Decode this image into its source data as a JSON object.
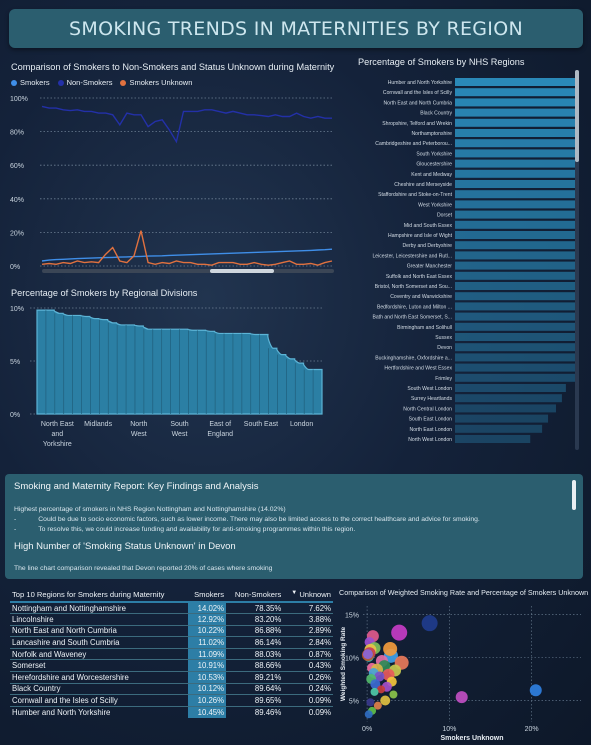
{
  "header": {
    "title": "SMOKING TRENDS IN MATERNITIES BY REGION"
  },
  "line_chart": {
    "title": "Comparison of Smokers to Non-Smokers and Status Unknown during Maternity",
    "legend": [
      {
        "name": "Smokers",
        "color": "#3f8ee8"
      },
      {
        "name": "Non-Smokers",
        "color": "#2330a8"
      },
      {
        "name": "Smokers Unknown",
        "color": "#e0713f"
      }
    ]
  },
  "area_chart": {
    "title": "Percentage of Smokers by Regional Divisions"
  },
  "bar_chart": {
    "title": "Percentage of Smokers by NHS Regions"
  },
  "findings": {
    "heading": "Smoking and Maternity Report: Key Findings and Analysis",
    "line1": "Highest percentage of smokers in NHS Region Nottingham and Nottinghamshire (14.02%)",
    "bullet1_mark": "-",
    "bullet1": "Could be due to socio economic factors, such as lower income. There may also be limited access to the correct healthcare and advice for smoking.",
    "bullet2_mark": "-",
    "bullet2": "To resolve this, we could increase funding and availability for anti-smoking programmes within this region.",
    "subheading": "High Number of 'Smoking Status Unknown' in Devon",
    "line2": "The line chart comparison revealed that Devon reported 20% of cases where smoking"
  },
  "table": {
    "headers": [
      "Top 10 Regions for Smokers during Maternity",
      "Smokers",
      "Non-Smokers",
      "Unknown"
    ],
    "sort_arrow": "▼",
    "rows": [
      [
        "Nottingham and Nottinghamshire",
        "14.02%",
        "78.35%",
        "7.62%"
      ],
      [
        "Lincolnshire",
        "12.92%",
        "83.20%",
        "3.88%"
      ],
      [
        "North East and North Cumbria",
        "10.22%",
        "86.88%",
        "2.89%"
      ],
      [
        "Lancashire and South Cumbria",
        "11.02%",
        "86.14%",
        "2.84%"
      ],
      [
        "Norfolk and Waveney",
        "11.09%",
        "88.03%",
        "0.87%"
      ],
      [
        "Somerset",
        "10.91%",
        "88.66%",
        "0.43%"
      ],
      [
        "Herefordshire and Worcestershire",
        "10.53%",
        "89.21%",
        "0.26%"
      ],
      [
        "Black Country",
        "10.12%",
        "89.64%",
        "0.24%"
      ],
      [
        "Cornwall and the Isles of Scilly",
        "10.26%",
        "89.65%",
        "0.09%"
      ],
      [
        "Humber and North Yorkshire",
        "10.45%",
        "89.46%",
        "0.09%"
      ]
    ]
  },
  "scatter": {
    "title": "Comparison of Weighted Smoking Rate and Percentage of Smokers Unknown",
    "xlabel": "Smokers Unknown",
    "ylabel": "Weighted Smoking Rate"
  },
  "chart_data": [
    {
      "type": "line",
      "title": "Comparison of Smokers to Non-Smokers and Status Unknown during Maternity",
      "ylim": [
        0,
        100
      ],
      "yticks": [
        "0%",
        "20%",
        "40%",
        "60%",
        "80%",
        "100%"
      ],
      "grid": true,
      "legend_position": "top-left",
      "series": [
        {
          "name": "Smokers",
          "color": "#3f8ee8",
          "values": [
            3,
            3.5,
            3.8,
            4,
            4.2,
            4.4,
            4.6,
            4.7,
            4.9,
            5,
            5.1,
            5.3,
            5.4,
            5.6,
            5.7,
            5.9,
            6,
            6.1,
            6.3,
            6.4,
            6.6,
            6.7,
            6.9,
            7,
            7.2,
            7.3,
            7.5,
            7.6,
            7.8,
            7.9,
            8.1,
            8.2,
            8.4,
            8.5,
            8.7,
            8.8,
            9,
            9.1,
            9.3,
            9.5,
            9.7,
            10
          ]
        },
        {
          "name": "Non-Smokers",
          "color": "#2330a8",
          "values": [
            95,
            94,
            94,
            93,
            92.5,
            93,
            92,
            92,
            91,
            91,
            90,
            84,
            91,
            90,
            90,
            83,
            86,
            87,
            81,
            74,
            92,
            92,
            92,
            93,
            93,
            92,
            91,
            92,
            91,
            90,
            90,
            89.5,
            89,
            90,
            89,
            89,
            91,
            89,
            88,
            89,
            88,
            88
          ]
        },
        {
          "name": "Smokers Unknown",
          "color": "#e0713f",
          "values": [
            1,
            1.5,
            1,
            2,
            1.5,
            3,
            2,
            2.5,
            2,
            7,
            11,
            3,
            2,
            6,
            21,
            2,
            1,
            2,
            1.5,
            3,
            2,
            2,
            1,
            1,
            0.5,
            2,
            2,
            2,
            1,
            1,
            2,
            1,
            0.5,
            1,
            2,
            3,
            1,
            1,
            1.5,
            0.5,
            2,
            3
          ]
        }
      ]
    },
    {
      "type": "area",
      "title": "Percentage of Smokers by Regional Divisions",
      "categories": [
        "North East and Yorkshire",
        "Midlands",
        "North West",
        "South West",
        "East of England",
        "South East",
        "London"
      ],
      "ylim": [
        0,
        10
      ],
      "yticks": [
        "0%",
        "5%",
        "10%"
      ],
      "segment_values": [
        9.8,
        9.8,
        9.5,
        9.3,
        9.3,
        9.2,
        9.0,
        8.9,
        8.6,
        8.4,
        8.4,
        8.3,
        8.0,
        8.0,
        8.0,
        8.0,
        8.0,
        7.9,
        7.9,
        7.8,
        7.6,
        7.6,
        7.6,
        7.6,
        7.5,
        7.5,
        6.2,
        5.6,
        5.2,
        4.8,
        4.2,
        4.2
      ]
    },
    {
      "type": "bar",
      "orientation": "horizontal",
      "title": "Percentage of Smokers by NHS Regions",
      "categories": [
        "Humber and North Yorkshire",
        "Cornwall and the Isles of Scilly",
        "North East and North Cumbria",
        "Black Country",
        "Shropshire, Telford and Wrekin",
        "Northamptonshire",
        "Cambridgeshire and Peterborou...",
        "South Yorkshire",
        "Gloucestershire",
        "Kent and Medway",
        "Cheshire and Merseyside",
        "Staffordshire and Stoke-on-Trent",
        "West Yorkshire",
        "Dorset",
        "Mid and South Essex",
        "Hampshire and Isle of Wight",
        "Derby and Derbyshire",
        "Leicester, Leicestershire and Rutl...",
        "Greater Manchester",
        "Suffolk and North East Essex",
        "Bristol, North Somerset and Sou...",
        "Coventry and Warwickshire",
        "Bedfordshire, Luton and Milton ...",
        "Bath and North East Somerset, S...",
        "Birmingham and Solihull",
        "Sussex",
        "Devon",
        "Buckinghamshire, Oxfordshire a...",
        "Hertfordshire and West Essex",
        "Frimley",
        "South West London",
        "Surrey Heartlands",
        "North Central London",
        "South East London",
        "North East London",
        "North West London"
      ],
      "values": [
        10.45,
        10.26,
        10.22,
        10.12,
        10.0,
        9.9,
        9.7,
        9.6,
        9.5,
        9.4,
        9.3,
        9.2,
        9.1,
        8.9,
        8.8,
        8.7,
        8.5,
        8.4,
        8.3,
        8.2,
        8.1,
        7.9,
        7.8,
        7.6,
        7.5,
        7.3,
        7.0,
        6.6,
        6.3,
        6.1,
        5.6,
        5.4,
        5.1,
        4.7,
        4.4,
        3.8
      ],
      "xlim": [
        0,
        11
      ]
    },
    {
      "type": "scatter",
      "title": "Comparison of Weighted Smoking Rate and Percentage of Smokers Unknown",
      "xlabel": "Smokers Unknown",
      "ylabel": "Weighted Smoking Rate",
      "xticks": [
        "0%",
        "10%",
        "20%"
      ],
      "yticks": [
        "5%",
        "10%",
        "15%"
      ],
      "xlim": [
        -0.5,
        26
      ],
      "ylim": [
        2.5,
        16
      ],
      "points": [
        {
          "x": 7.6,
          "y": 14.0,
          "color": "#1f3c8c",
          "r": 8
        },
        {
          "x": 3.9,
          "y": 12.9,
          "color": "#c63cc4",
          "r": 8
        },
        {
          "x": 0.7,
          "y": 12.5,
          "color": "#e05a8c",
          "r": 6
        },
        {
          "x": 0.3,
          "y": 11.8,
          "color": "#9b4fd0",
          "r": 5
        },
        {
          "x": 2.9,
          "y": 10.2,
          "color": "#3fa0e8",
          "r": 7
        },
        {
          "x": 2.8,
          "y": 11.0,
          "color": "#f29a3c",
          "r": 7
        },
        {
          "x": 0.9,
          "y": 11.1,
          "color": "#7fbf5a",
          "r": 6
        },
        {
          "x": 0.4,
          "y": 10.9,
          "color": "#e8c347",
          "r": 6
        },
        {
          "x": 0.3,
          "y": 10.5,
          "color": "#c9385a",
          "r": 6
        },
        {
          "x": 0.2,
          "y": 10.1,
          "color": "#4ec7b5",
          "r": 5
        },
        {
          "x": 0.1,
          "y": 10.3,
          "color": "#b9552e",
          "r": 6
        },
        {
          "x": 0.1,
          "y": 10.4,
          "color": "#8a66d9",
          "r": 5
        },
        {
          "x": 1.8,
          "y": 9.6,
          "color": "#e36fa7",
          "r": 6
        },
        {
          "x": 4.2,
          "y": 9.4,
          "color": "#e87a5a",
          "r": 7
        },
        {
          "x": 2.1,
          "y": 9.0,
          "color": "#2e8b57",
          "r": 6
        },
        {
          "x": 0.6,
          "y": 8.8,
          "color": "#f06ca0",
          "r": 5
        },
        {
          "x": 1.2,
          "y": 8.6,
          "color": "#d6b44a",
          "r": 6
        },
        {
          "x": 3.4,
          "y": 8.5,
          "color": "#c7c94f",
          "r": 6
        },
        {
          "x": 0.8,
          "y": 8.2,
          "color": "#49a3d6",
          "r": 5
        },
        {
          "x": 2.6,
          "y": 8.0,
          "color": "#e85a5a",
          "r": 6
        },
        {
          "x": 1.5,
          "y": 7.8,
          "color": "#7a52c7",
          "r": 5
        },
        {
          "x": 0.5,
          "y": 7.5,
          "color": "#53b86a",
          "r": 5
        },
        {
          "x": 3.0,
          "y": 7.2,
          "color": "#f3c43c",
          "r": 5
        },
        {
          "x": 1.0,
          "y": 6.9,
          "color": "#3c6ad0",
          "r": 5
        },
        {
          "x": 2.4,
          "y": 6.6,
          "color": "#a44fc9",
          "r": 5
        },
        {
          "x": 1.7,
          "y": 6.3,
          "color": "#c73c3c",
          "r": 4
        },
        {
          "x": 0.9,
          "y": 6.0,
          "color": "#4fc9a8",
          "r": 4
        },
        {
          "x": 3.2,
          "y": 5.7,
          "color": "#8bc34a",
          "r": 4
        },
        {
          "x": 11.5,
          "y": 5.4,
          "color": "#c04ec2",
          "r": 6
        },
        {
          "x": 20.5,
          "y": 6.2,
          "color": "#2f7fe0",
          "r": 6
        },
        {
          "x": 2.2,
          "y": 5.0,
          "color": "#e0c040",
          "r": 5
        },
        {
          "x": 0.4,
          "y": 4.8,
          "color": "#3a3a8c",
          "r": 4
        },
        {
          "x": 1.3,
          "y": 4.4,
          "color": "#e0804a",
          "r": 4
        },
        {
          "x": 0.6,
          "y": 3.8,
          "color": "#5fbf4a",
          "r": 4
        },
        {
          "x": 0.2,
          "y": 3.4,
          "color": "#2f6bc0",
          "r": 4
        }
      ]
    }
  ]
}
